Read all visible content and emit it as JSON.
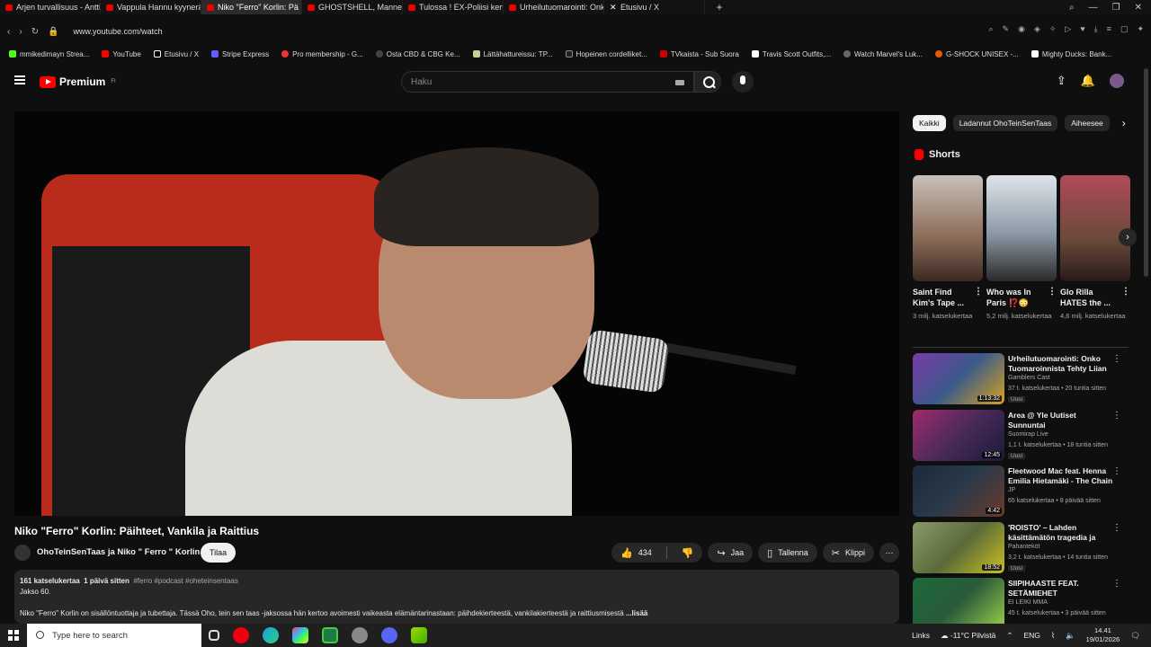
{
  "browser": {
    "tabs": [
      {
        "label": "Arjen turvallisuus - Antti"
      },
      {
        "label": "Vappula Hannu kyynerän"
      },
      {
        "label": "Niko \"Ferro\" Korlin: Pä"
      },
      {
        "label": "GHOSTSHELL, Mannequi"
      },
      {
        "label": "Tulossa ! EX-Poliisi kerto"
      },
      {
        "label": "Urheilutuomarointi: Onko"
      },
      {
        "label": "Etusivu / X"
      }
    ],
    "active_tab_index": 2,
    "url": "www.youtube.com/watch",
    "bookmarks": [
      "mmikedimayn Strea...",
      "YouTube",
      "Etusivu / X",
      "Stripe Express",
      "Pro membership - G...",
      "Osta CBD & CBG Ke...",
      "Lättähattureissu: TP...",
      "Hopeinen cordelliket...",
      "TVkaista - Sub Suora",
      "Travis Scott Outfits,...",
      "Watch Marvel's Luk...",
      "G-SHOCK UNISEX -...",
      "Mighty Ducks: Bank..."
    ]
  },
  "header": {
    "logo_text": "Premium",
    "logo_region": "FI",
    "search_placeholder": "Haku"
  },
  "video": {
    "title": "Niko \"Ferro\" Korlin: Päihteet, Vankila ja Raittius",
    "channel": "OhoTeinSenTaas ja Niko \" Ferro \" Korlin",
    "subscribe_label": "Tilaa",
    "like_count": "434",
    "share_label": "Jaa",
    "save_label": "Tallenna",
    "clip_label": "Klippi",
    "description": {
      "views": "161 katselukertaa",
      "date": "1 päivä sitten",
      "tags": "#ferro #podcast #oheteinsentaas",
      "episode": "Jakso 60.",
      "text": "Niko \"Ferro\" Korlin on sisällöntuottaja ja tubettaja. Tässä Oho, tein sen taas -jaksossa hän kertoo avoimesti vaikeasta elämäntarinastaan: päihdekierteestä, vankilakierteestä ja raittiusmisestä",
      "more": "...lisää"
    }
  },
  "sidebar": {
    "chips": [
      "Kaikki",
      "Ladannut OhoTeinSenTaas",
      "Aiheesee"
    ],
    "shorts_title": "Shorts",
    "shorts": [
      {
        "title": "Saint Find Kim's Tape ...",
        "views": "3 milj. katselukertaa",
        "color": "#8a6a58"
      },
      {
        "title": "Who was In Paris ⁉️😳",
        "views": "5,2 milj. katselukertaa",
        "color": "#8c9aa6"
      },
      {
        "title": "Glo Rilla HATES the ...",
        "views": "4,6 milj. katselukertaa",
        "color": "#6b4a3a"
      }
    ],
    "recommendations": [
      {
        "title": "Urheilutuomarointi: Onko Tuomaroinnista Tehty Liian ...",
        "channel": "Gamblers Cast",
        "meta": "37 t. katselukertaa • 20 tuntia sitten",
        "badge": "Uusi",
        "duration": "1:13:32",
        "color": "#3a5a8a"
      },
      {
        "title": "Area @ Yle Uutiset Sunnuntai",
        "channel": "Suomirap Live",
        "meta": "1,1 t. katselukertaa • 18 tuntia sitten",
        "badge": "Uusi",
        "duration": "12:45",
        "color": "#4a2a5a"
      },
      {
        "title": "Fleetwood Mac feat. Henna Emilia Hietamäki - The Chain",
        "channel": "JP",
        "meta": "65 katselukertaa • 8 päivää sitten",
        "badge": "",
        "duration": "4:42",
        "color": "#2a3a4a"
      },
      {
        "title": "'ROISTO' – Lahden käsittämätön tragedia ja klovn...",
        "channel": "Pahanteköt",
        "meta": "3,2 t. katselukertaa • 14 tuntia sitten",
        "badge": "Uusi",
        "duration": "18:52",
        "color": "#5a6a3a"
      },
      {
        "title": "SIIPIHAASTE FEAT. SETÄMIEHET",
        "channel": "EI LEIKI MMA",
        "meta": "45 t. katselukertaa • 3 päivää sitten",
        "badge": "",
        "duration": "",
        "color": "#2a5a3a"
      }
    ]
  },
  "taskbar": {
    "search_placeholder": "Type here to search",
    "links_label": "Links",
    "weather": "-11°C Pilvistä",
    "lang": "ENG",
    "time": "14.41",
    "date": "19/01/2026"
  }
}
